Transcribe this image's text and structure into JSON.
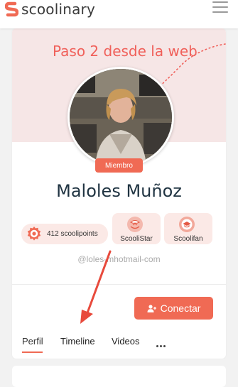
{
  "header": {
    "logo_text": "scoolinary",
    "brand_color": "#f06a54",
    "menu_icon": "hamburger-icon"
  },
  "profile": {
    "annotation": "Paso 2 desde la web",
    "badge": "Miembro",
    "name": "Maloles Muñoz",
    "points_label": "412  scoolipoints",
    "awards": [
      {
        "label": "ScooliStar",
        "icon": "star-award-icon"
      },
      {
        "label": "Scoolifan",
        "icon": "graduation-cap-icon"
      }
    ],
    "email": "@loles-mhotmail-com"
  },
  "actions": {
    "connect_label": "Conectar",
    "connect_icon": "add-user-icon"
  },
  "tabs": [
    {
      "label": "Perfil",
      "active": true
    },
    {
      "label": "Timeline",
      "active": false
    },
    {
      "label": "Videos",
      "active": false
    }
  ],
  "more_icon": "more-horizontal-icon"
}
